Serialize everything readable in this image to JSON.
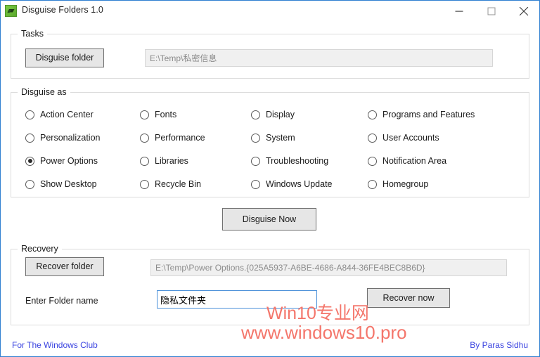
{
  "window": {
    "title": "Disguise Folders 1.0",
    "icon": "app-icon",
    "controls": {
      "minimize": "minimize-icon",
      "maximize": "maximize-icon",
      "close": "close-icon"
    },
    "border_color": "#2f7fd1"
  },
  "tasks": {
    "group_label": "Tasks",
    "disguise_folder_button": "Disguise folder",
    "path_value": "E:\\Temp\\私密信息"
  },
  "disguise_as": {
    "group_label": "Disguise as",
    "selected": "Power Options",
    "options": [
      {
        "label": "Action Center",
        "checked": false
      },
      {
        "label": "Personalization",
        "checked": false
      },
      {
        "label": "Power Options",
        "checked": true
      },
      {
        "label": "Show Desktop",
        "checked": false
      },
      {
        "label": "Fonts",
        "checked": false
      },
      {
        "label": "Performance",
        "checked": false
      },
      {
        "label": "Libraries",
        "checked": false
      },
      {
        "label": "Recycle Bin",
        "checked": false
      },
      {
        "label": "Display",
        "checked": false
      },
      {
        "label": "System",
        "checked": false
      },
      {
        "label": "Troubleshooting",
        "checked": false
      },
      {
        "label": "Windows Update",
        "checked": false
      },
      {
        "label": "Programs and Features",
        "checked": false
      },
      {
        "label": "User Accounts",
        "checked": false
      },
      {
        "label": "Notification Area",
        "checked": false
      },
      {
        "label": "Homegroup",
        "checked": false
      }
    ]
  },
  "actions": {
    "disguise_now_button": "Disguise Now"
  },
  "recovery": {
    "group_label": "Recovery",
    "recover_folder_button": "Recover folder",
    "path_value": "E:\\Temp\\Power Options.{025A5937-A6BE-4686-A844-36FE4BEC8B6D}",
    "folder_name_label": "Enter Folder name",
    "folder_name_value": "隐私文件夹",
    "recover_now_button": "Recover now"
  },
  "footer": {
    "left_link": "For The Windows Club",
    "right_link": "By Paras Sidhu",
    "link_color": "#3a43e0"
  },
  "watermark": {
    "line1": "Win10专业网",
    "line2": "www.windows10.pro",
    "color": "#f4766b"
  }
}
